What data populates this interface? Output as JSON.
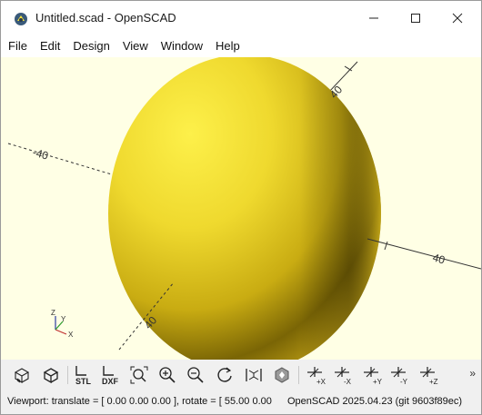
{
  "window": {
    "title": "Untitled.scad - OpenSCAD",
    "minimize_icon": "minimize-icon",
    "maximize_icon": "maximize-icon",
    "close_icon": "close-icon"
  },
  "menu": [
    {
      "label": "File"
    },
    {
      "label": "Edit"
    },
    {
      "label": "Design"
    },
    {
      "label": "View"
    },
    {
      "label": "Window"
    },
    {
      "label": "Help"
    }
  ],
  "viewport": {
    "background_color": "#ffffe5",
    "object_color": "#f5e33b",
    "axis_labels": {
      "neg_x": "-40",
      "pos_x": "40",
      "pos_y": "40",
      "neg_y": "40",
      "top": "0"
    },
    "gizmo": {
      "x": "X",
      "y": "Y",
      "z": "Z"
    }
  },
  "toolbar": {
    "buttons": [
      {
        "name": "preview-button",
        "icon": "preview-icon"
      },
      {
        "name": "render-button",
        "icon": "render-icon"
      },
      {
        "name": "export-stl-button",
        "icon": "stl-icon",
        "label": "STL"
      },
      {
        "name": "export-dxf-button",
        "icon": "dxf-icon",
        "label": "DXF"
      },
      {
        "name": "view-all-button",
        "icon": "view-all-icon"
      },
      {
        "name": "zoom-in-button",
        "icon": "zoom-in-icon"
      },
      {
        "name": "zoom-out-button",
        "icon": "zoom-out-icon"
      },
      {
        "name": "reset-view-button",
        "icon": "reset-view-icon"
      },
      {
        "name": "perspective-button",
        "icon": "perspective-icon"
      },
      {
        "name": "orthogonal-button",
        "icon": "orthogonal-icon"
      },
      {
        "name": "view-right-button",
        "icon": "view-right-icon",
        "label": "+X"
      },
      {
        "name": "view-left-button",
        "icon": "view-left-icon",
        "label": "-X"
      },
      {
        "name": "view-back-button",
        "icon": "view-back-icon",
        "label": "+Y"
      },
      {
        "name": "view-front-button",
        "icon": "view-front-icon",
        "label": "-Y"
      },
      {
        "name": "view-top-button",
        "icon": "view-top-icon",
        "label": "+Z"
      }
    ],
    "more": "»"
  },
  "status": {
    "viewport": "Viewport: translate = [ 0.00 0.00 0.00 ], rotate = [ 55.00 0.00",
    "version": "OpenSCAD 2025.04.23 (git 9603f89ec)"
  }
}
